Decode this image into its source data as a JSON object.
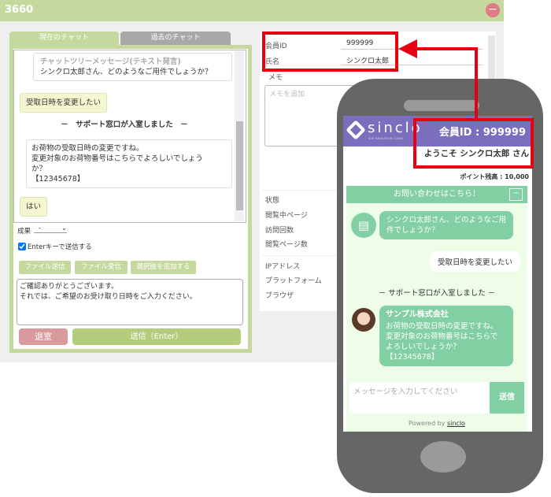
{
  "window": {
    "title": "3660",
    "minimize_icon": "minus-circle-icon"
  },
  "tabs": [
    {
      "label": "現在のチャット"
    },
    {
      "label": "過去のチャット"
    }
  ],
  "chat": {
    "tree_label": "チャットツリーメッセージ(テキスト発言)",
    "tree_msg": "シンクロ太郎さん、どのようなご用件でしょうか？",
    "customer1": "受取日時を変更したい",
    "system": "－　サポート窓口が入室しました　－",
    "op_lines": [
      "お荷物の受取日時の変更ですね。",
      "変更対象のお荷物番号はこちらでよろしいでしょう",
      "か？",
      "【12345678】"
    ],
    "customer2": "はい"
  },
  "controls": {
    "result_label": "成果",
    "result_value": "-",
    "enter_checkbox": "Enterキーで送信する",
    "enter_checked": true,
    "file_send": "ファイル送信",
    "file_receive": "ファイル受信",
    "add_choice": "選択肢を追加する",
    "input_lines": [
      "ご確認ありがとうございます。",
      "それでは、ご希望のお受け取り日時をご入力ください。"
    ],
    "exit": "退室",
    "send": "送信（Enter）"
  },
  "customer_info": {
    "member_id_label": "会員ID",
    "member_id": "999999",
    "name_label": "氏名",
    "name": "シンクロ太郎",
    "memo_label": "メモ",
    "memo_placeholder": "メモを追加",
    "fields": [
      "状態",
      "閲覧中ページ",
      "訪問回数",
      "閲覧ページ数"
    ],
    "fields2": [
      "IPアドレス",
      "プラットフォーム",
      "ブラウザ"
    ]
  },
  "phone": {
    "logo": "sinclo",
    "logo_sub": "SITE NAVIGATION CLOUD",
    "member_id": "会員ID : 999999",
    "welcome": "ようこそ シンクロ太郎 さん",
    "points": "ポイント残高 : 10,000",
    "widget_title": "お問い合わせはこちら！",
    "bot_msg": "シンクロ太郎さん、どのようなご用件でしょうか？",
    "user_msg": "受取日時を変更したい",
    "system": "－ サポート窓口が入室しました －",
    "company": "サンプル株式会社",
    "op_lines": [
      "お荷物の受取日時の変更ですね。",
      "変更対象のお荷物番号はこちらで",
      "よろしいでしょうか？",
      "【12345678】"
    ],
    "input_placeholder": "メッセージを入力してください",
    "send": "送信",
    "powered": "Powered by",
    "powered_brand": "sinclo"
  },
  "colors": {
    "accent_green": "#c5d99e",
    "highlight_red": "#e60012",
    "sinclo_purple": "#7b6fbd",
    "widget_green": "#82cfa3"
  }
}
